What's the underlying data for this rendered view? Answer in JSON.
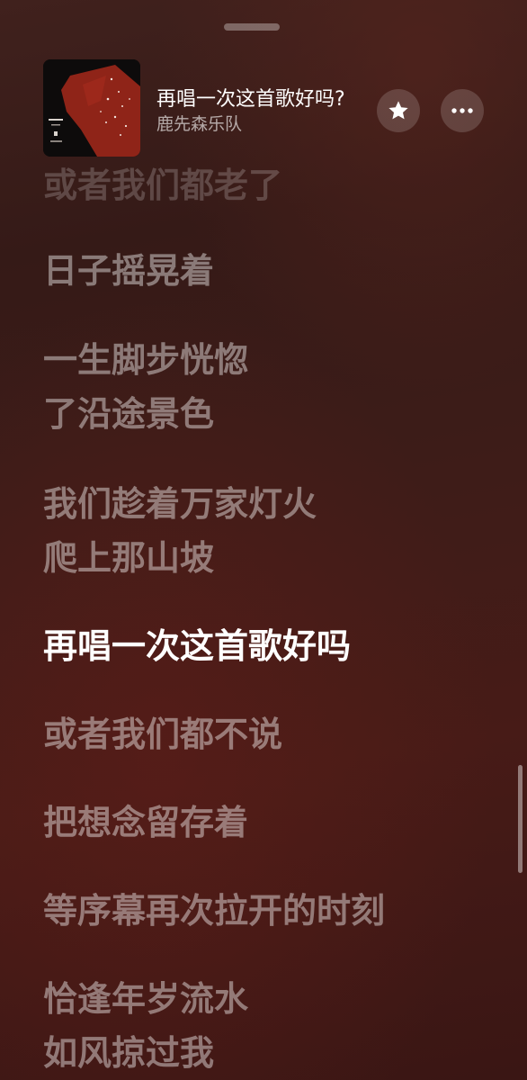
{
  "now_playing": {
    "title": "再唱一次这首歌好吗?",
    "artist": "鹿先森乐队",
    "cover_icon": "album-cover-art",
    "favorite_icon": "star-icon",
    "more_icon": "ellipsis-icon"
  },
  "lyrics": [
    {
      "text": "或者我们都老了",
      "state": "past"
    },
    {
      "text": "日子摇晃着",
      "state": "upcoming"
    },
    {
      "text": "一生脚步恍惚",
      "state": "upcoming"
    },
    {
      "text": "了沿途景色",
      "state": "upcoming"
    },
    {
      "text": "我们趁着万家灯火",
      "state": "upcoming"
    },
    {
      "text": "爬上那山坡",
      "state": "upcoming"
    },
    {
      "text": "再唱一次这首歌好吗",
      "state": "active"
    },
    {
      "text": "或者我们都不说",
      "state": "upcoming"
    },
    {
      "text": "把想念留存着",
      "state": "upcoming"
    },
    {
      "text": "等序幕再次拉开的时刻",
      "state": "upcoming"
    },
    {
      "text": "恰逢年岁流水",
      "state": "upcoming"
    },
    {
      "text": "如风掠过我",
      "state": "upcoming"
    }
  ],
  "colors": {
    "accent": "#ffffff",
    "background": "#3d1c18",
    "album_red": "#8f2418"
  }
}
